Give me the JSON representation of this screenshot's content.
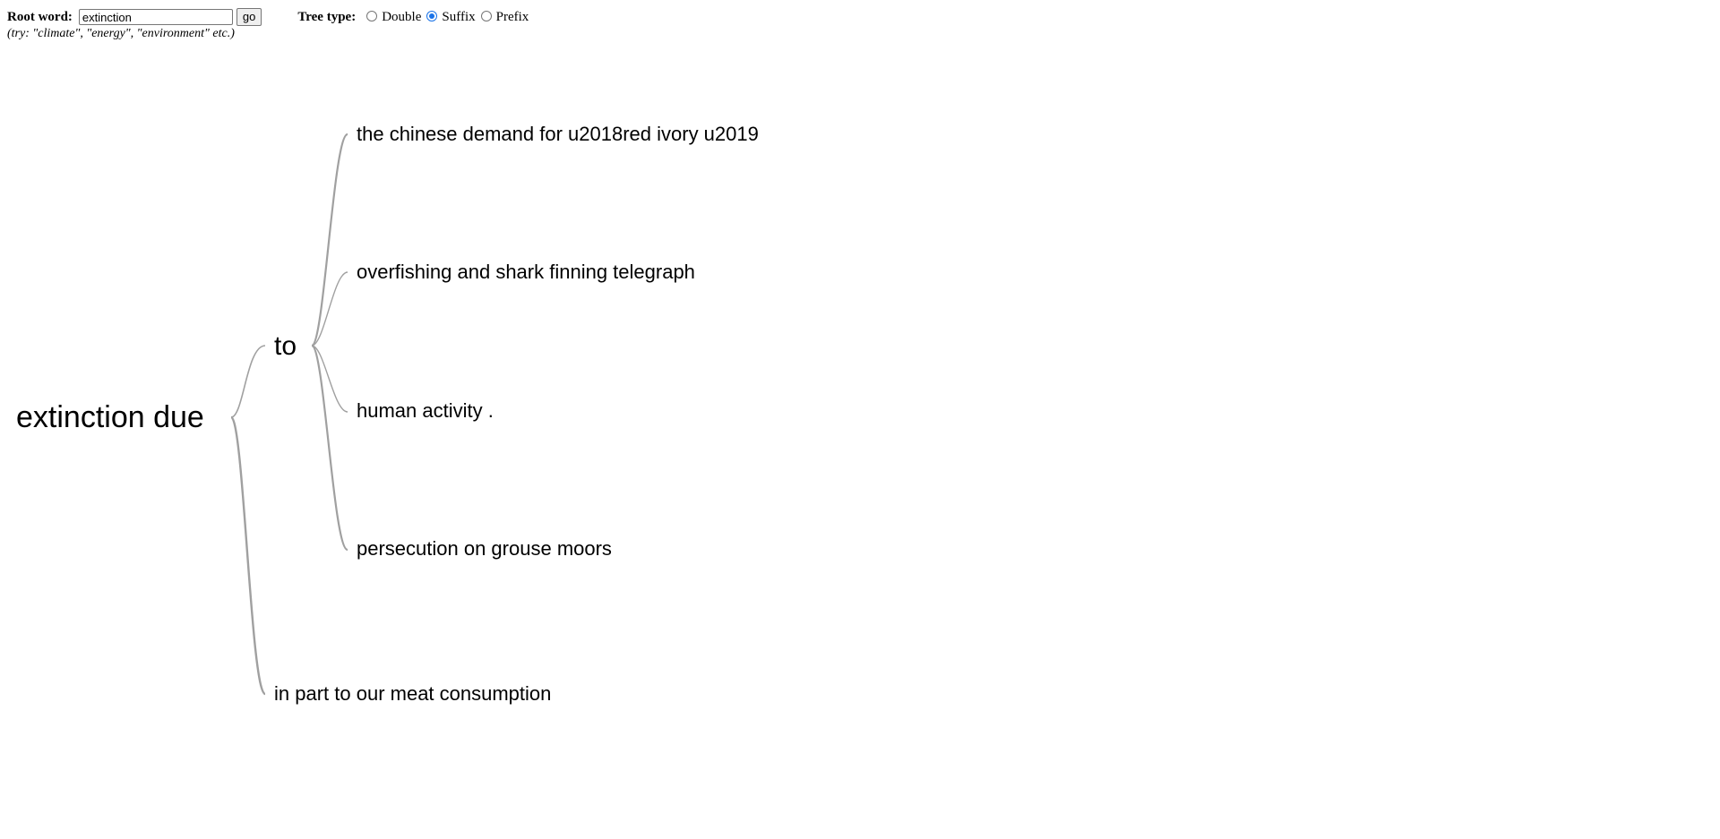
{
  "controls": {
    "root_label": "Root word:",
    "root_value": "extinction",
    "go_label": "go",
    "tree_type_label": "Tree type:",
    "options": [
      {
        "label": "Double",
        "checked": false
      },
      {
        "label": "Suffix",
        "checked": true
      },
      {
        "label": "Prefix",
        "checked": false
      }
    ],
    "hint": "(try: \"climate\", \"energy\", \"environment\" etc.)"
  },
  "tree": {
    "root": "extinction due",
    "children": [
      {
        "label": "to",
        "children": [
          {
            "label": "the chinese demand for u2018red ivory u2019"
          },
          {
            "label": "overfishing and shark finning telegraph"
          },
          {
            "label": "human activity ."
          },
          {
            "label": "persecution on grouse moors"
          }
        ]
      },
      {
        "label": "in part to our meat consumption"
      }
    ]
  },
  "colors": {
    "edge": "#a0a0a0",
    "radio_accent": "#1a73e8"
  }
}
